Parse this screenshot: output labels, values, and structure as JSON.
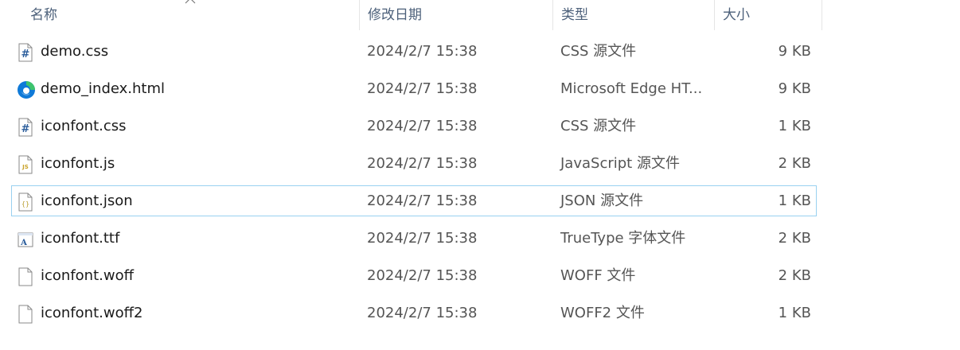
{
  "columns": {
    "name": "名称",
    "date": "修改日期",
    "type": "类型",
    "size": "大小"
  },
  "files": [
    {
      "name": "demo.css",
      "date": "2024/2/7 15:38",
      "type": "CSS 源文件",
      "size": "9 KB",
      "icon": "css-file-icon"
    },
    {
      "name": "demo_index.html",
      "date": "2024/2/7 15:38",
      "type": "Microsoft Edge HT...",
      "size": "9 KB",
      "icon": "edge-html-file-icon"
    },
    {
      "name": "iconfont.css",
      "date": "2024/2/7 15:38",
      "type": "CSS 源文件",
      "size": "1 KB",
      "icon": "css-file-icon"
    },
    {
      "name": "iconfont.js",
      "date": "2024/2/7 15:38",
      "type": "JavaScript 源文件",
      "size": "2 KB",
      "icon": "js-file-icon"
    },
    {
      "name": "iconfont.json",
      "date": "2024/2/7 15:38",
      "type": "JSON 源文件",
      "size": "1 KB",
      "icon": "json-file-icon",
      "focused": true
    },
    {
      "name": "iconfont.ttf",
      "date": "2024/2/7 15:38",
      "type": "TrueType 字体文件",
      "size": "2 KB",
      "icon": "font-file-icon"
    },
    {
      "name": "iconfont.woff",
      "date": "2024/2/7 15:38",
      "type": "WOFF 文件",
      "size": "2 KB",
      "icon": "blank-file-icon"
    },
    {
      "name": "iconfont.woff2",
      "date": "2024/2/7 15:38",
      "type": "WOFF2 文件",
      "size": "1 KB",
      "icon": "blank-file-icon"
    }
  ],
  "colors": {
    "header_text": "#4c607a",
    "focus_border": "#99d1f0",
    "edge_blue": "#0f7ad8",
    "edge_green": "#3ec46d"
  }
}
